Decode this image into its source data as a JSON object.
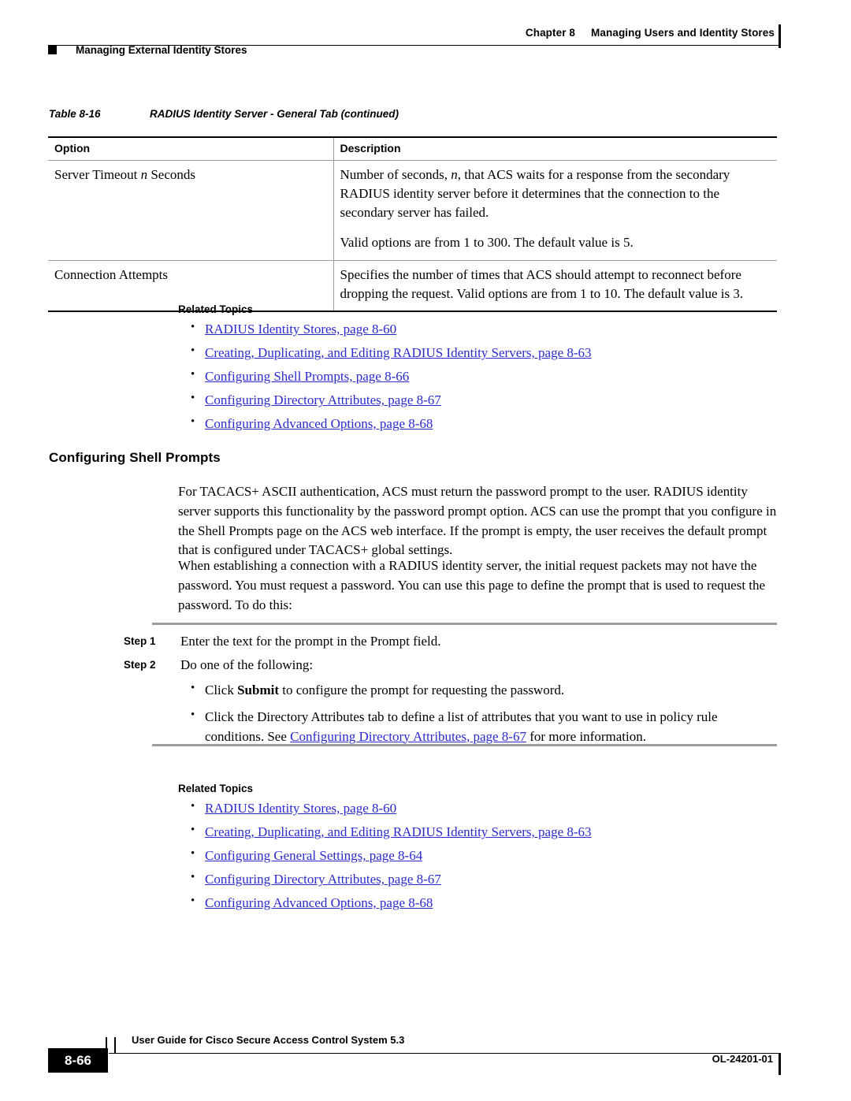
{
  "header": {
    "chapter_number": "Chapter 8",
    "chapter_title": "Managing Users and Identity Stores",
    "section_title": "Managing External Identity Stores"
  },
  "table": {
    "caption_number": "Table 8-16",
    "caption_title": "RADIUS Identity Server - General Tab (continued)",
    "columns": [
      "Option",
      "Description"
    ],
    "rows": [
      {
        "option_prefix": "Server Timeout ",
        "option_italic": "n",
        "option_suffix": " Seconds",
        "description_paragraphs": [
          "Number of seconds, n, that ACS waits for a response from the secondary RADIUS identity server before it determines that the connection to the secondary server has failed.",
          "Valid options are from 1 to 300. The default value is 5."
        ]
      },
      {
        "option": "Connection Attempts",
        "description_paragraphs": [
          "Specifies the number of times that ACS should attempt to reconnect before dropping the request. Valid options are from 1 to 10. The default value is 3."
        ]
      }
    ]
  },
  "related_topics_1": {
    "title": "Related Topics",
    "links": [
      "RADIUS Identity Stores, page 8-60",
      "Creating, Duplicating, and Editing RADIUS Identity Servers, page 8-63",
      "Configuring Shell Prompts, page 8-66",
      "Configuring Directory Attributes, page 8-67",
      "Configuring Advanced Options, page 8-68"
    ]
  },
  "section": {
    "heading": "Configuring Shell Prompts",
    "paragraph_1": "For TACACS+ ASCII authentication, ACS must return the password prompt to the user. RADIUS identity server supports this functionality by the password prompt option. ACS can use the prompt that you configure in the Shell Prompts page on the ACS web interface. If the prompt is empty, the user receives the default prompt that is configured under TACACS+ global settings.",
    "paragraph_2": "When establishing a connection with a RADIUS identity server, the initial request packets may not have the password. You must request a password. You can use this page to define the prompt that is used to request the password. To do this:"
  },
  "procedure": {
    "step1_label": "Step 1",
    "step1_text": "Enter the text for the prompt in the Prompt field.",
    "step2_label": "Step 2",
    "step2_text": "Do one of the following:",
    "bullet1_pre": "Click ",
    "bullet1_bold": "Submit",
    "bullet1_post": " to configure the prompt for requesting the password.",
    "bullet2_pre": "Click the Directory Attributes tab to define a list of attributes that you want to use in policy rule conditions. See ",
    "bullet2_link": "Configuring Directory Attributes, page 8-67",
    "bullet2_post": " for more information."
  },
  "related_topics_2": {
    "title": "Related Topics",
    "links": [
      "RADIUS Identity Stores, page 8-60",
      "Creating, Duplicating, and Editing RADIUS Identity Servers, page 8-63",
      "Configuring General Settings, page 8-64",
      "Configuring Directory Attributes, page 8-67",
      "Configuring Advanced Options, page 8-68"
    ]
  },
  "footer": {
    "page_number": "8-66",
    "guide_title": "User Guide for Cisco Secure Access Control System 5.3",
    "doc_id": "OL-24201-01"
  },
  "colors": {
    "link": "#2a2ad0",
    "rule": "#9c9c9c",
    "text": "#000000"
  }
}
